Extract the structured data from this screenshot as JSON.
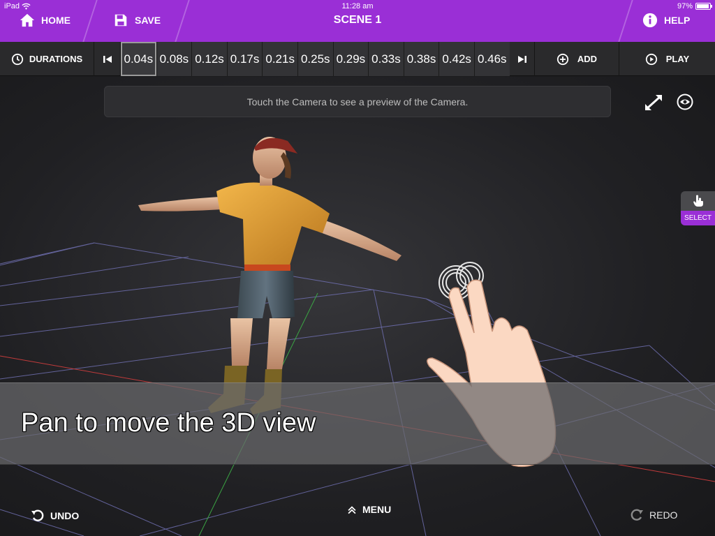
{
  "status_bar": {
    "device": "iPad",
    "time": "11:28 am",
    "battery": "97%"
  },
  "top_bar": {
    "home_label": "HOME",
    "save_label": "SAVE",
    "scene_title": "SCENE 1",
    "help_label": "HELP"
  },
  "timeline": {
    "durations_label": "DURATIONS",
    "frames": [
      "0.04s",
      "0.08s",
      "0.12s",
      "0.17s",
      "0.21s",
      "0.25s",
      "0.29s",
      "0.33s",
      "0.38s",
      "0.42s",
      "0.46s"
    ],
    "active_frame": "0.04s",
    "add_label": "ADD",
    "play_label": "PLAY"
  },
  "viewport": {
    "hint": "Touch the Camera to see a preview of the Camera.",
    "select_label": "SELECT"
  },
  "tutorial": {
    "message": "Pan to move the 3D view"
  },
  "bottom_bar": {
    "undo_label": "UNDO",
    "menu_label": "MENU",
    "redo_label": "REDO"
  },
  "colors": {
    "accent": "#9a2fd6",
    "toolbar": "#2a2a2c",
    "viewport": "#202023"
  },
  "icons": [
    "wifi-icon",
    "home-icon",
    "save-icon",
    "info-icon",
    "clock-icon",
    "skip-start-icon",
    "skip-end-icon",
    "plus-circle-icon",
    "play-circle-icon",
    "expand-icon",
    "eye-icon",
    "pointer-hand-icon",
    "undo-icon",
    "chevron-up-icon",
    "redo-icon"
  ]
}
